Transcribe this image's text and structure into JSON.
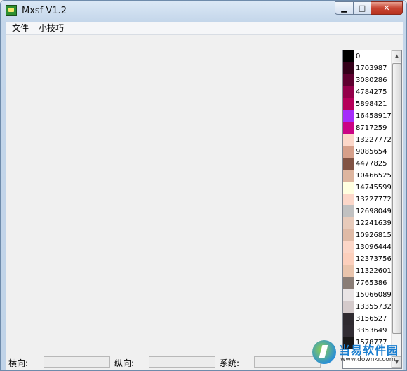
{
  "window": {
    "title": "Mxsf V1.2"
  },
  "menu": {
    "items": [
      "文件",
      "小技巧"
    ]
  },
  "palette": {
    "colors": [
      {
        "code": "0",
        "hex": "#000000"
      },
      {
        "code": "1703987",
        "hex": "#330019"
      },
      {
        "code": "3080286",
        "hex": "#5E002F"
      },
      {
        "code": "4784275",
        "hex": "#93004A"
      },
      {
        "code": "5898421",
        "hex": "#B5005A"
      },
      {
        "code": "16458917",
        "hex": "#A52DFB"
      },
      {
        "code": "8717259",
        "hex": "#CB0385"
      },
      {
        "code": "13227772",
        "hex": "#FCD7C9"
      },
      {
        "code": "9085654",
        "hex": "#D69F8A"
      },
      {
        "code": "4477825",
        "hex": "#815344"
      },
      {
        "code": "10466525",
        "hex": "#DDB59F"
      },
      {
        "code": "14745599",
        "hex": "#FFFFE0"
      },
      {
        "code": "13227772",
        "hex": "#FCD7C9"
      },
      {
        "code": "12698049",
        "hex": "#C1C1C1"
      },
      {
        "code": "12241639",
        "hex": "#E7CABA"
      },
      {
        "code": "10926815",
        "hex": "#DFBAA6"
      },
      {
        "code": "13096444",
        "hex": "#FCD6C7"
      },
      {
        "code": "12373756",
        "hex": "#FCCFBC"
      },
      {
        "code": "11322601",
        "hex": "#E9C4AC"
      },
      {
        "code": "7765386",
        "hex": "#8A7D76"
      },
      {
        "code": "15066089",
        "hex": "#E9E4E5"
      },
      {
        "code": "13355732",
        "hex": "#D4CACB"
      },
      {
        "code": "3156527",
        "hex": "#2F2A30"
      },
      {
        "code": "3353649",
        "hex": "#312C33"
      },
      {
        "code": "1578777",
        "hex": "#191718"
      }
    ]
  },
  "status": {
    "horizontal_label": "横向:",
    "vertical_label": "纵向:",
    "system_label": "系统:"
  },
  "watermark": {
    "title": "当易软件园",
    "url": "www.downkr.com"
  }
}
